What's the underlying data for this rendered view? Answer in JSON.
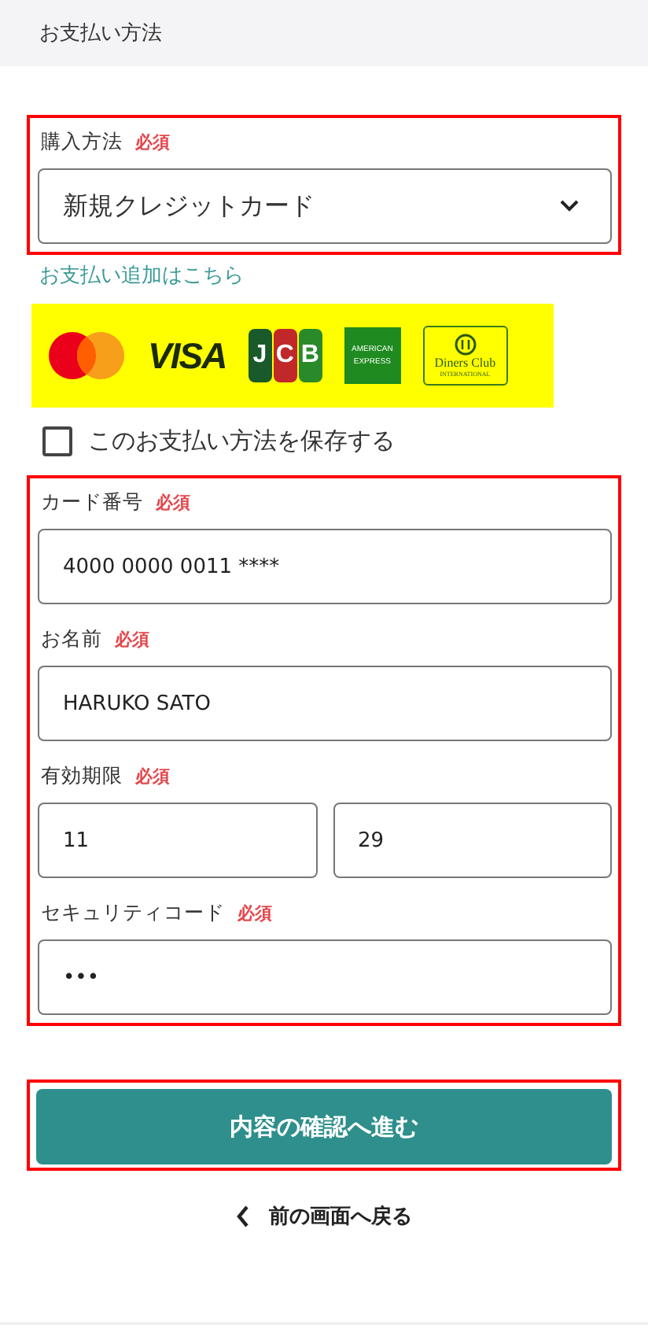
{
  "header": {
    "title": "お支払い方法"
  },
  "purchase_method": {
    "label": "購入方法",
    "required": "必須",
    "value": "新規クレジットカード",
    "highlighted": true
  },
  "add_payment_link": "お支払い追加はこちら",
  "card_brands": [
    {
      "kind": "mastercard"
    },
    {
      "kind": "visa",
      "label": "VISA"
    },
    {
      "kind": "jcb",
      "letters": [
        "J",
        "C",
        "B"
      ]
    },
    {
      "kind": "amex",
      "label": "AMERICAN",
      "sublabel": "EXPRESS"
    },
    {
      "kind": "diners",
      "label": "Diners Club",
      "sublabel": "INTERNATIONAL"
    }
  ],
  "save_option": {
    "label": "このお支払い方法を保存する",
    "checked": false
  },
  "card_form": {
    "highlighted": true,
    "fields": [
      {
        "kind": "single",
        "label": "カード番号",
        "required": "必須",
        "values": [
          "4000 0000 0011  ****"
        ]
      },
      {
        "kind": "single",
        "label": "お名前",
        "required": "必須",
        "values": [
          "HARUKO SATO"
        ]
      },
      {
        "kind": "pair",
        "label": "有効期限",
        "required": "必須",
        "values": [
          "11",
          "29"
        ]
      },
      {
        "kind": "single",
        "label": "セキュリティコード",
        "required": "必須",
        "values": [
          "•••"
        ]
      }
    ]
  },
  "confirm_button": {
    "label": "内容の確認へ進む",
    "highlighted": true
  },
  "back_link": {
    "label": "前の画面へ戻る"
  }
}
